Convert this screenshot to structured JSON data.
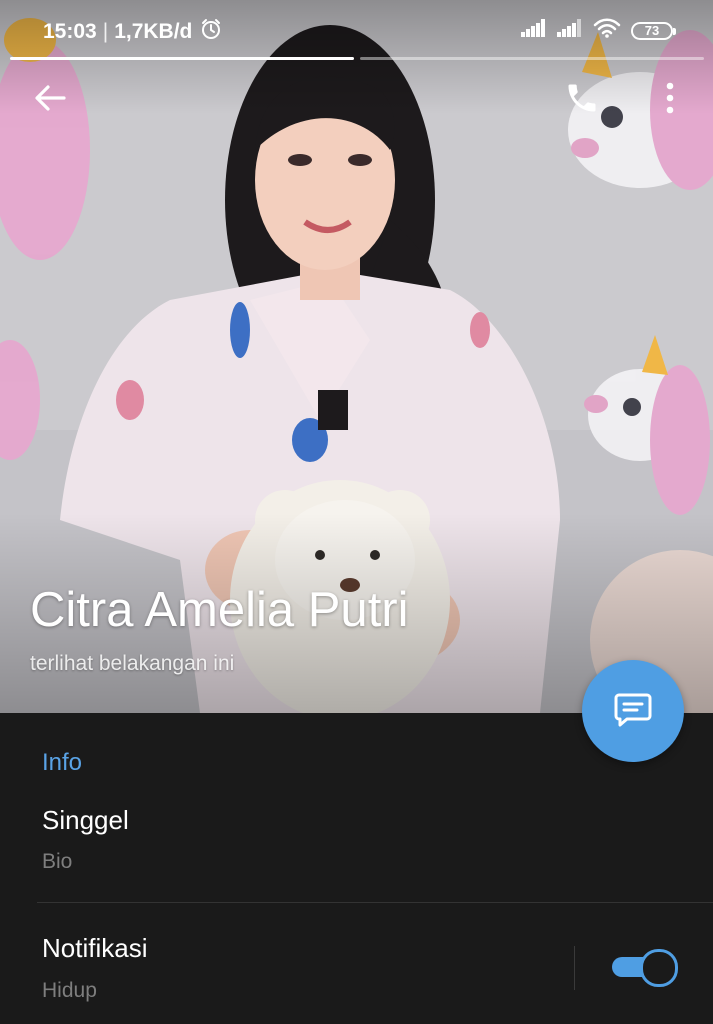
{
  "status_bar": {
    "time": "15:03",
    "network_speed": "1,7KB/d",
    "battery": "73",
    "icons": [
      "alarm-icon",
      "signal-icon",
      "signal-icon",
      "wifi-icon",
      "battery-icon"
    ]
  },
  "story_progress": {
    "segments": 2,
    "active_index": 0
  },
  "toolbar": {
    "back_icon": "arrow-left-icon",
    "call_icon": "phone-icon",
    "menu_icon": "more-vertical-icon"
  },
  "profile": {
    "name": "Citra Amelia Putri",
    "last_seen": "terlihat belakangan ini"
  },
  "fab": {
    "icon": "message-icon"
  },
  "info": {
    "section_title": "Info",
    "bio_value": "Singgel",
    "bio_label": "Bio",
    "notifications_title": "Notifikasi",
    "notifications_status": "Hidup",
    "notifications_enabled": true
  },
  "colors": {
    "accent": "#4f9ee3",
    "section_title": "#5aa3e6",
    "background": "#1a1a1a",
    "secondary_text": "#7e7e7e"
  }
}
